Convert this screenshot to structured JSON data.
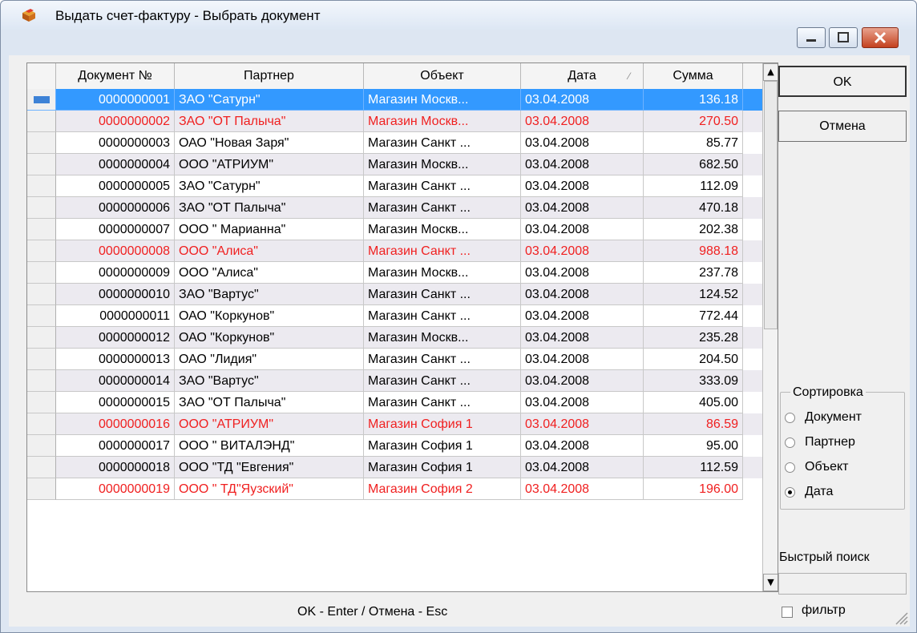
{
  "window": {
    "title": "Выдать счет-фактуру - Выбрать документ"
  },
  "grid": {
    "columns": [
      "Документ №",
      "Партнер",
      "Объект",
      "Дата",
      "Сумма"
    ],
    "sorted_column": "Дата",
    "selected_row": 0,
    "rows": [
      {
        "doc": "0000000001",
        "partner": "ЗАО \"Сатурн\"",
        "object": "Магазин Москв...",
        "date": "03.04.2008",
        "sum": "136.18",
        "red": false
      },
      {
        "doc": "0000000002",
        "partner": "ЗАО \"ОТ Палыча\"",
        "object": "Магазин Москв...",
        "date": "03.04.2008",
        "sum": "270.50",
        "red": true
      },
      {
        "doc": "0000000003",
        "partner": "ОАО \"Новая Заря\"",
        "object": "Магазин Санкт ...",
        "date": "03.04.2008",
        "sum": "85.77",
        "red": false
      },
      {
        "doc": "0000000004",
        "partner": "ООО \"АТРИУМ\"",
        "object": "Магазин Москв...",
        "date": "03.04.2008",
        "sum": "682.50",
        "red": false
      },
      {
        "doc": "0000000005",
        "partner": "ЗАО \"Сатурн\"",
        "object": "Магазин Санкт ...",
        "date": "03.04.2008",
        "sum": "112.09",
        "red": false
      },
      {
        "doc": "0000000006",
        "partner": "ЗАО \"ОТ Палыча\"",
        "object": "Магазин Санкт ...",
        "date": "03.04.2008",
        "sum": "470.18",
        "red": false
      },
      {
        "doc": "0000000007",
        "partner": "ООО \" Марианна\"",
        "object": "Магазин Москв...",
        "date": "03.04.2008",
        "sum": "202.38",
        "red": false
      },
      {
        "doc": "0000000008",
        "partner": "ООО \"Алиса\"",
        "object": "Магазин Санкт ...",
        "date": "03.04.2008",
        "sum": "988.18",
        "red": true
      },
      {
        "doc": "0000000009",
        "partner": "ООО \"Алиса\"",
        "object": "Магазин Москв...",
        "date": "03.04.2008",
        "sum": "237.78",
        "red": false
      },
      {
        "doc": "0000000010",
        "partner": "ЗАО \"Вартус\"",
        "object": "Магазин Санкт ...",
        "date": "03.04.2008",
        "sum": "124.52",
        "red": false
      },
      {
        "doc": "0000000011",
        "partner": "ОАО \"Коркунов\"",
        "object": "Магазин Санкт ...",
        "date": "03.04.2008",
        "sum": "772.44",
        "red": false
      },
      {
        "doc": "0000000012",
        "partner": "ОАО \"Коркунов\"",
        "object": "Магазин Москв...",
        "date": "03.04.2008",
        "sum": "235.28",
        "red": false
      },
      {
        "doc": "0000000013",
        "partner": "ОАО \"Лидия\"",
        "object": "Магазин Санкт ...",
        "date": "03.04.2008",
        "sum": "204.50",
        "red": false
      },
      {
        "doc": "0000000014",
        "partner": "ЗАО \"Вартус\"",
        "object": "Магазин Санкт ...",
        "date": "03.04.2008",
        "sum": "333.09",
        "red": false
      },
      {
        "doc": "0000000015",
        "partner": "ЗАО \"ОТ Палыча\"",
        "object": "Магазин Санкт ...",
        "date": "03.04.2008",
        "sum": "405.00",
        "red": false
      },
      {
        "doc": "0000000016",
        "partner": "ООО \"АТРИУМ\"",
        "object": "Магазин София 1",
        "date": "03.04.2008",
        "sum": "86.59",
        "red": true
      },
      {
        "doc": "0000000017",
        "partner": "ООО \" ВИТАЛЭНД\"",
        "object": "Магазин София 1",
        "date": "03.04.2008",
        "sum": "95.00",
        "red": false
      },
      {
        "doc": "0000000018",
        "partner": "ООО \"ТД \"Евгения\"",
        "object": "Магазин София 1",
        "date": "03.04.2008",
        "sum": "112.59",
        "red": false
      },
      {
        "doc": "0000000019",
        "partner": "ООО \" ТД\"Яузский\"",
        "object": "Магазин София 2",
        "date": "03.04.2008",
        "sum": "196.00",
        "red": true
      }
    ]
  },
  "buttons": {
    "ok": "OK",
    "cancel": "Отмена"
  },
  "sort": {
    "title": "Сортировка",
    "options": [
      "Документ",
      "Партнер",
      "Объект",
      "Дата"
    ],
    "selected": "Дата"
  },
  "quick_search": {
    "label": "Быстрый поиск",
    "value": ""
  },
  "filter": {
    "label": "фильтр",
    "checked": false
  },
  "status": "OK - Enter / Отмена - Esc",
  "colors": {
    "selection": "#3399ff",
    "red_rows": "#f02020",
    "alt_row": "#eceaf0"
  }
}
